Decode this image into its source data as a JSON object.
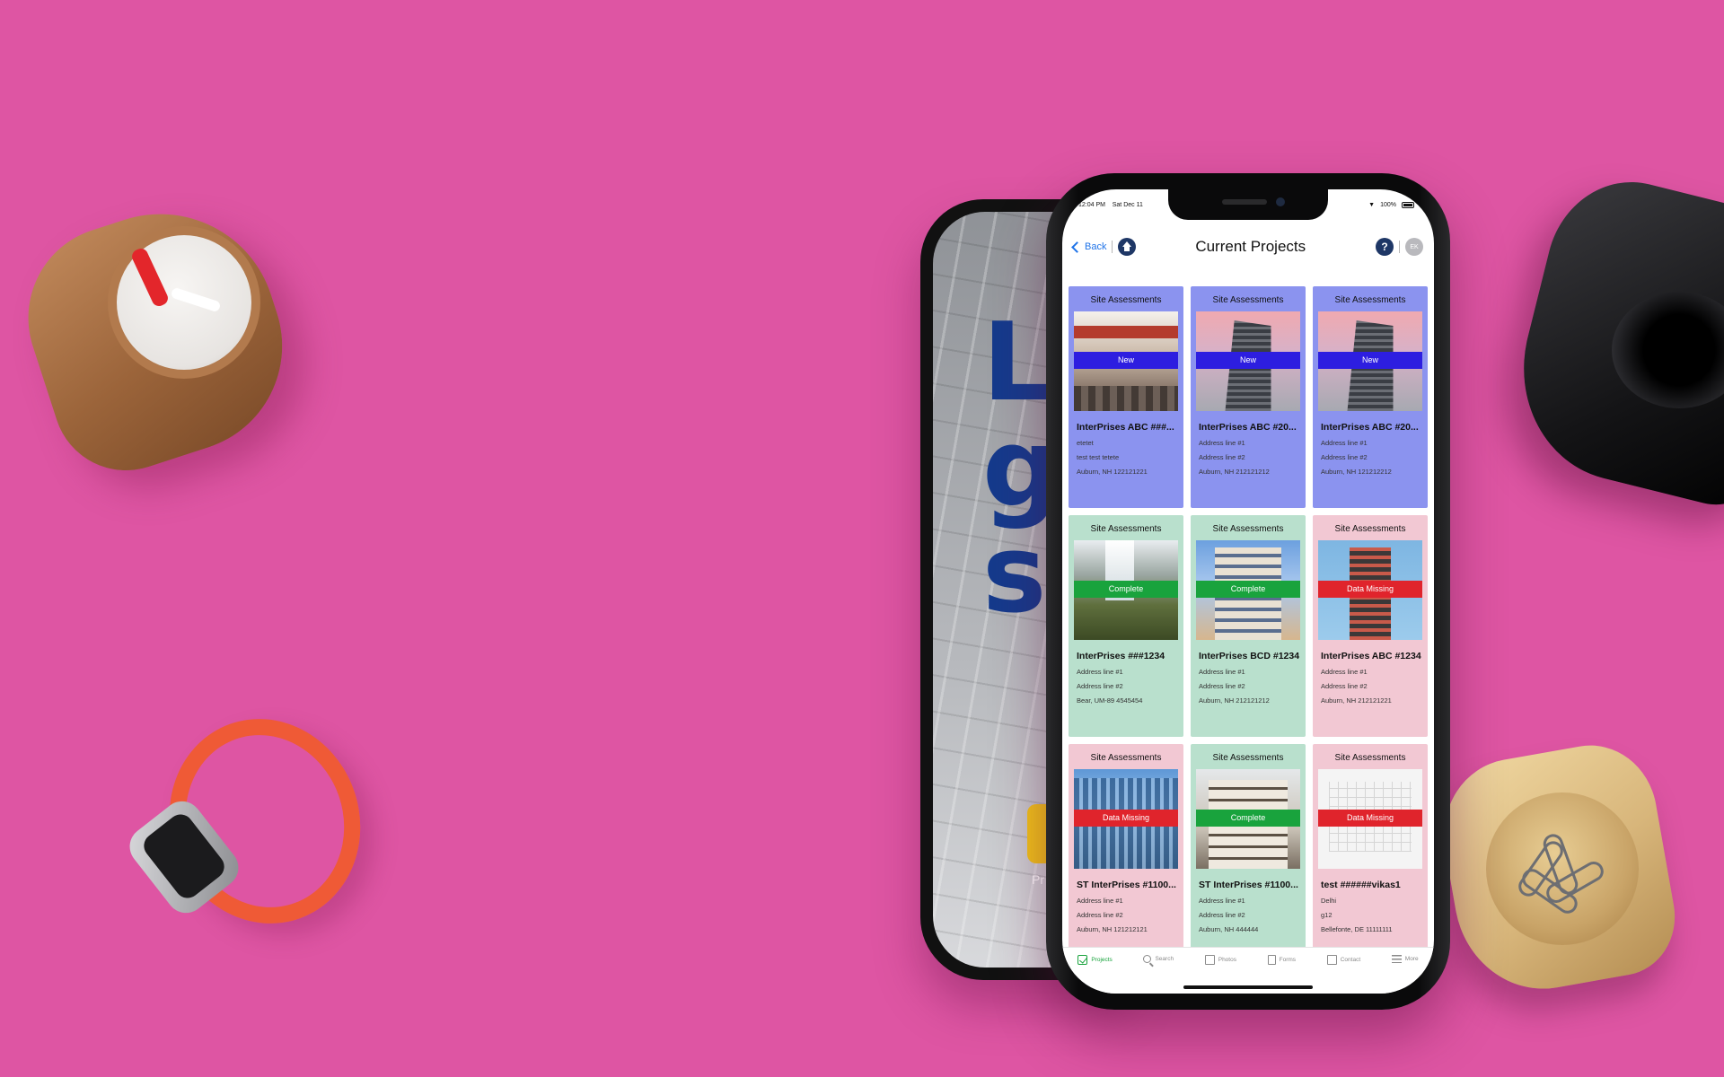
{
  "background_color": "#de55a3",
  "status_bar": {
    "time": "12:04 PM",
    "date": "Sat Dec 11",
    "battery": "100%"
  },
  "header": {
    "back_label": "Back",
    "title": "Current Projects",
    "avatar_initials": "EK"
  },
  "back_phone": {
    "letters": "L\ng\ns",
    "folder_label": "Pr"
  },
  "projects": [
    {
      "category": "Site Assessments",
      "status": "New",
      "status_color": "#2d1ee0",
      "card_color": "#8b93ef",
      "name": "InterPrises ABC ###...",
      "line1": "etetet",
      "line2": "test test tetete",
      "line3": "Auburn, NH 122121221"
    },
    {
      "category": "Site Assessments",
      "status": "New",
      "status_color": "#2d1ee0",
      "card_color": "#8b93ef",
      "name": "InterPrises ABC #20...",
      "line1": "Address line #1",
      "line2": "Address line #2",
      "line3": "Auburn, NH 212121212"
    },
    {
      "category": "Site Assessments",
      "status": "New",
      "status_color": "#2d1ee0",
      "card_color": "#8b93ef",
      "name": "InterPrises ABC #20...",
      "line1": "Address line #1",
      "line2": "Address line #2",
      "line3": "Auburn, NH 121212212"
    },
    {
      "category": "Site Assessments",
      "status": "Complete",
      "status_color": "#19a33d",
      "card_color": "#b9e0cd",
      "name": "InterPrises ###1234",
      "line1": "Address line #1",
      "line2": "Address line #2",
      "line3": "Bear, UM-89 4545454"
    },
    {
      "category": "Site Assessments",
      "status": "Complete",
      "status_color": "#19a33d",
      "card_color": "#b9e0cd",
      "name": "InterPrises BCD #1234",
      "line1": "Address line #1",
      "line2": "Address line #2",
      "line3": "Auburn, NH 212121212"
    },
    {
      "category": "Site Assessments",
      "status": "Data Missing",
      "status_color": "#e0242c",
      "card_color": "#f2c8d3",
      "name": "InterPrises ABC #1234",
      "line1": "Address line #1",
      "line2": "Address line #2",
      "line3": "Auburn, NH 212121221"
    },
    {
      "category": "Site Assessments",
      "status": "Data Missing",
      "status_color": "#e0242c",
      "card_color": "#f2c8d3",
      "name": "ST InterPrises #1100...",
      "line1": "Address line #1",
      "line2": "Address line #2",
      "line3": "Auburn, NH 121212121"
    },
    {
      "category": "Site Assessments",
      "status": "Complete",
      "status_color": "#19a33d",
      "card_color": "#b9e0cd",
      "name": "ST InterPrises #1100...",
      "line1": "Address line #1",
      "line2": "Address line #2",
      "line3": "Auburn, NH 444444"
    },
    {
      "category": "Site Assessments",
      "status": "Data Missing",
      "status_color": "#e0242c",
      "card_color": "#f2c8d3",
      "name": "test ######vikas1",
      "line1": "Delhi",
      "line2": "g12",
      "line3": "Bellefonte, DE 11111111"
    }
  ],
  "tabs": [
    {
      "label": "Projects",
      "icon": "check-icon",
      "active": true
    },
    {
      "label": "Search",
      "icon": "search-icon",
      "active": false
    },
    {
      "label": "Photos",
      "icon": "photo-icon",
      "active": false
    },
    {
      "label": "Forms",
      "icon": "form-icon",
      "active": false
    },
    {
      "label": "Contact",
      "icon": "contact-icon",
      "active": false
    },
    {
      "label": "More",
      "icon": "more-icon",
      "active": false
    }
  ]
}
